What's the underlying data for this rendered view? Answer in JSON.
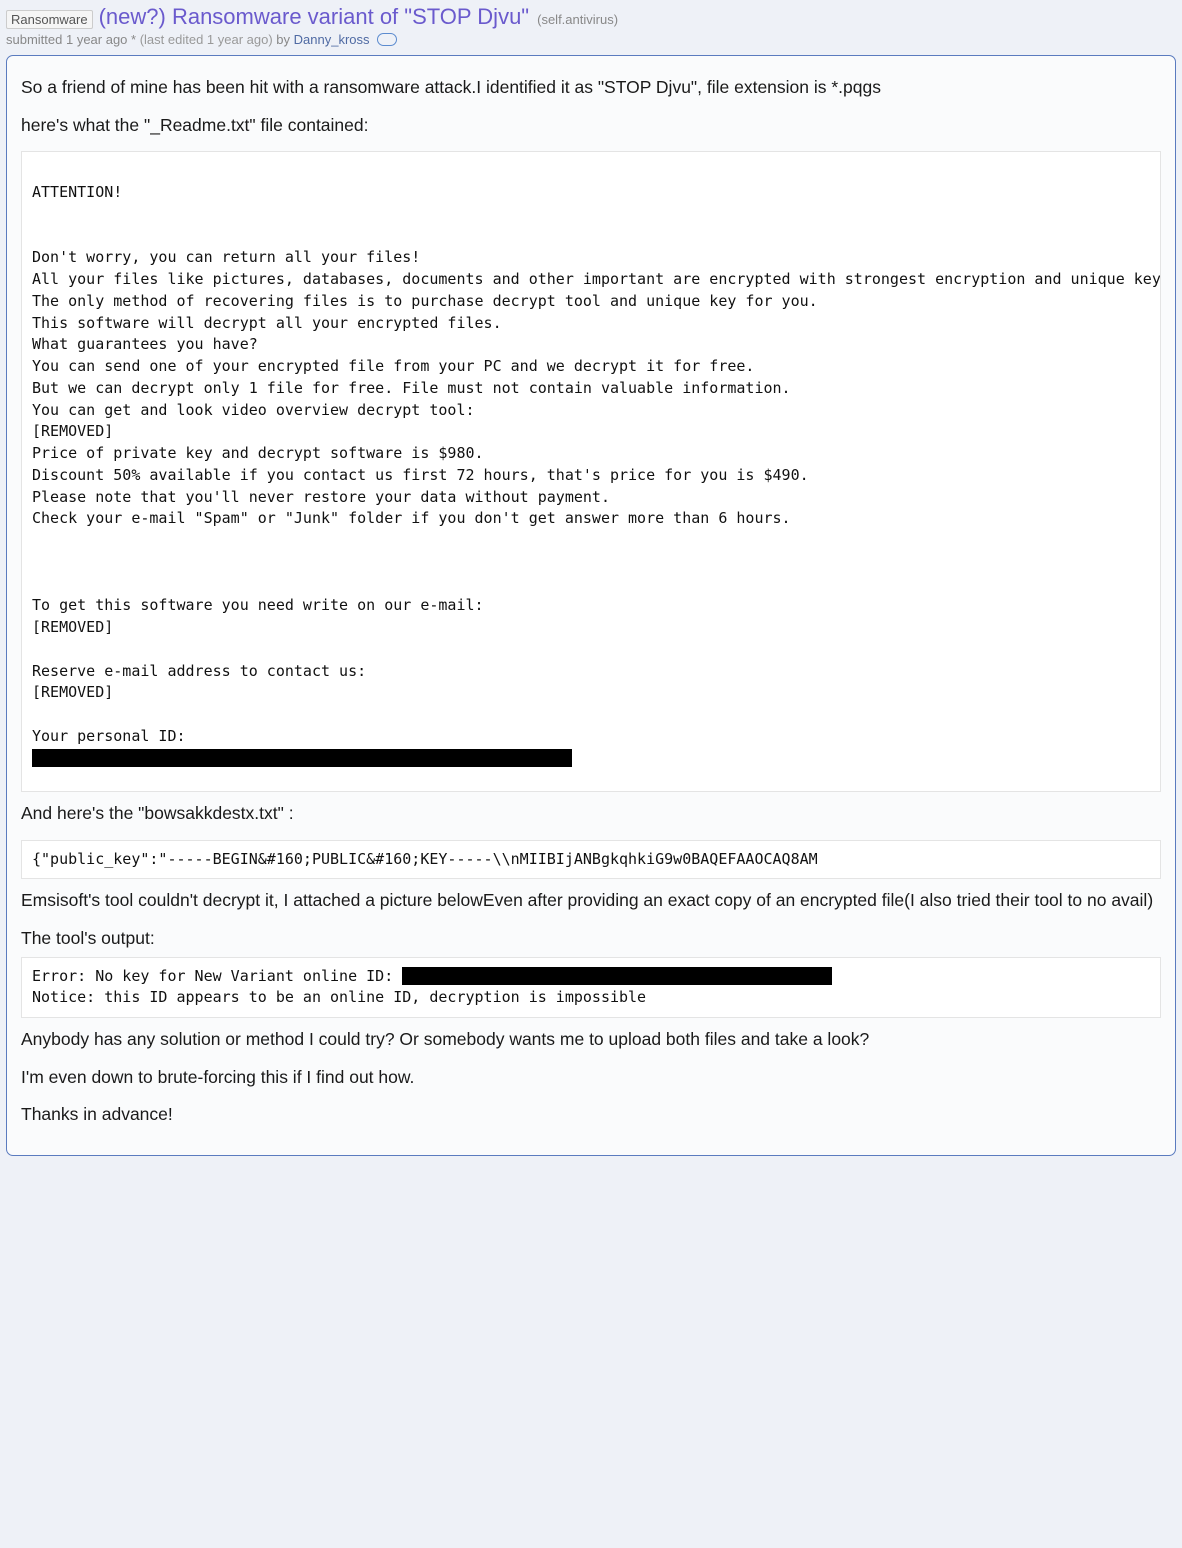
{
  "header": {
    "flair": "Ransomware",
    "title": "(new?) Ransomware variant of \"STOP Djvu\"",
    "domain": "(self.antivirus)",
    "submitted_prefix": "submitted ",
    "age": "1 year ago",
    "star": " * ",
    "edited": "(last edited 1 year ago)",
    "by": " by ",
    "author": "Danny_kross"
  },
  "body": {
    "p1": "So a friend of mine has been hit with a ransomware attack.I identified it as \"STOP Djvu\", file extension is *.pqgs",
    "p2": "here's what the \"_Readme.txt\" file contained:",
    "code1": "ATTENTION!\n\n\nDon't worry, you can return all your files!\nAll your files like pictures, databases, documents and other important are encrypted with strongest encryption and unique key.\nThe only method of recovering files is to purchase decrypt tool and unique key for you.\nThis software will decrypt all your encrypted files.\nWhat guarantees you have?\nYou can send one of your encrypted file from your PC and we decrypt it for free.\nBut we can decrypt only 1 file for free. File must not contain valuable information.\nYou can get and look video overview decrypt tool:\n[REMOVED]\nPrice of private key and decrypt software is $980.\nDiscount 50% available if you contact us first 72 hours, that's price for you is $490.\nPlease note that you'll never restore your data without payment.\nCheck your e-mail \"Spam\" or \"Junk\" folder if you don't get answer more than 6 hours.\n\n\n\nTo get this software you need write on our e-mail:\n[REMOVED]\n\nReserve e-mail address to contact us:\n[REMOVED]\n\nYour personal ID:",
    "p3": "And here's the \"bowsakkdestx.txt\" :",
    "code2": "{\"public_key\":\"-----BEGIN&#160;PUBLIC&#160;KEY-----\\\\nMIIBIjANBgkqhkiG9w0BAQEFAAOCAQ8AM",
    "p4": "Emsisoft's tool couldn't decrypt it, I attached a picture belowEven after providing an exact copy of an encrypted file(I also tried their tool to no avail)",
    "p5": "The tool's output:",
    "code3_a": "Error: No key for New Variant online ID: ",
    "code3_b": "Notice: this ID appears to be an online ID, decryption is impossible",
    "p6": "Anybody has any solution or method I could try? Or somebody wants me to upload both files and take a look?",
    "p7": "I'm even down to brute-forcing this if I find out how.",
    "p8": "Thanks in advance!"
  }
}
